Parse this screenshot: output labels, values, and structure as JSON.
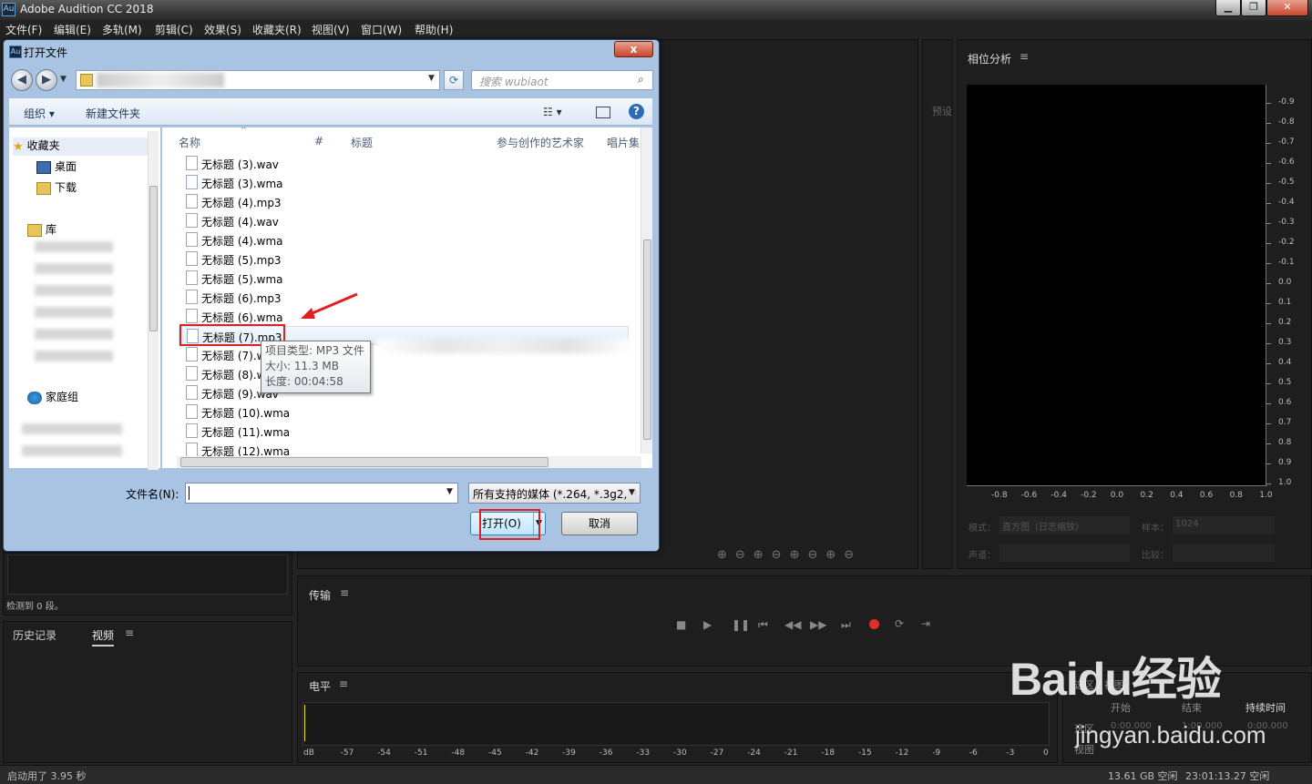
{
  "app": {
    "title": "Adobe Audition CC 2018",
    "logo": "Au"
  },
  "menu": [
    "文件(F)",
    "编辑(E)",
    "多轨(M)",
    "剪辑(C)",
    "效果(S)",
    "收藏夹(R)",
    "视图(V)",
    "窗口(W)",
    "帮助(H)"
  ],
  "left_panel": {
    "detect": "检测到 0 段。",
    "tabs": [
      "历史记录",
      "视频"
    ]
  },
  "phase_panel": {
    "title": "相位分析",
    "right_ticks": [
      "-0.9",
      "-0.8",
      "-0.7",
      "-0.6",
      "-0.5",
      "-0.4",
      "-0.3",
      "-0.2",
      "-0.1",
      "0.0",
      "0.1",
      "0.2",
      "0.3",
      "0.4",
      "0.5",
      "0.6",
      "0.7",
      "0.8",
      "0.9",
      "1.0"
    ],
    "bottom_ticks": [
      "-0.8",
      "-0.6",
      "-0.4",
      "-0.2",
      "0.0",
      "0.2",
      "0.4",
      "0.6",
      "0.8",
      "1.0"
    ],
    "mode_label": "模式：",
    "mode_value": "直方图（日志缩放）",
    "sample_label": "样本：",
    "sample_value": "1024",
    "channel_label": "声道：",
    "compare_label": "比较：",
    "preset_label": "预设"
  },
  "transport": {
    "title": "传输"
  },
  "levels": {
    "title": "电平",
    "ticks": [
      "dB",
      "-57",
      "-54",
      "-51",
      "-48",
      "-45",
      "-42",
      "-39",
      "-36",
      "-33",
      "-30",
      "-27",
      "-24",
      "-21",
      "-18",
      "-15",
      "-12",
      "-9",
      "-6",
      "-3",
      "0"
    ]
  },
  "selection_view": {
    "title": "选区 / 视图",
    "col1": "开始",
    "col2": "结束",
    "col3": "持续时间",
    "row1": "选区",
    "row2": "视图",
    "values": [
      "0:00.000",
      "1:00.000",
      "0:00.000"
    ]
  },
  "status_bar": {
    "left": "启动用了 3.95 秒",
    "disk": "13.61 GB 空闲",
    "time": "23:01:13.27 空闲"
  },
  "dialog": {
    "title": "打开文件",
    "close": "x",
    "search_placeholder": "搜索 wubiaot",
    "organize": "组织 ▾",
    "new_folder": "新建文件夹",
    "nav": {
      "favorites": "收藏夹",
      "desktop": "桌面",
      "downloads": "下载",
      "libraries": "库",
      "homegroup": "家庭组"
    },
    "columns": [
      "名称",
      "#",
      "标题",
      "参与创作的艺术家",
      "唱片集"
    ],
    "files": [
      "无标题 (3).wav",
      "无标题 (3).wma",
      "无标题 (4).mp3",
      "无标题 (4).wav",
      "无标题 (4).wma",
      "无标题 (5).mp3",
      "无标题 (5).wma",
      "无标题 (6).mp3",
      "无标题 (6).wma",
      "无标题 (7).mp3",
      "无标题 (7).wav",
      "无标题 (8).wav",
      "无标题 (9).wav",
      "无标题 (10).wma",
      "无标题 (11).wma",
      "无标题 (12).wma"
    ],
    "selected_index": 9,
    "tooltip": {
      "type": "项目类型: MP3 文件",
      "size": "大小: 11.3 MB",
      "length": "长度: 00:04:58"
    },
    "filename_label": "文件名(N):",
    "filename_value": "",
    "filetype": "所有支持的媒体 (*.264, *.3g2, *",
    "open": "打开(O)",
    "cancel": "取消"
  },
  "watermark": {
    "brand": "Baidu经验",
    "url": "jingyan.baidu.com"
  }
}
